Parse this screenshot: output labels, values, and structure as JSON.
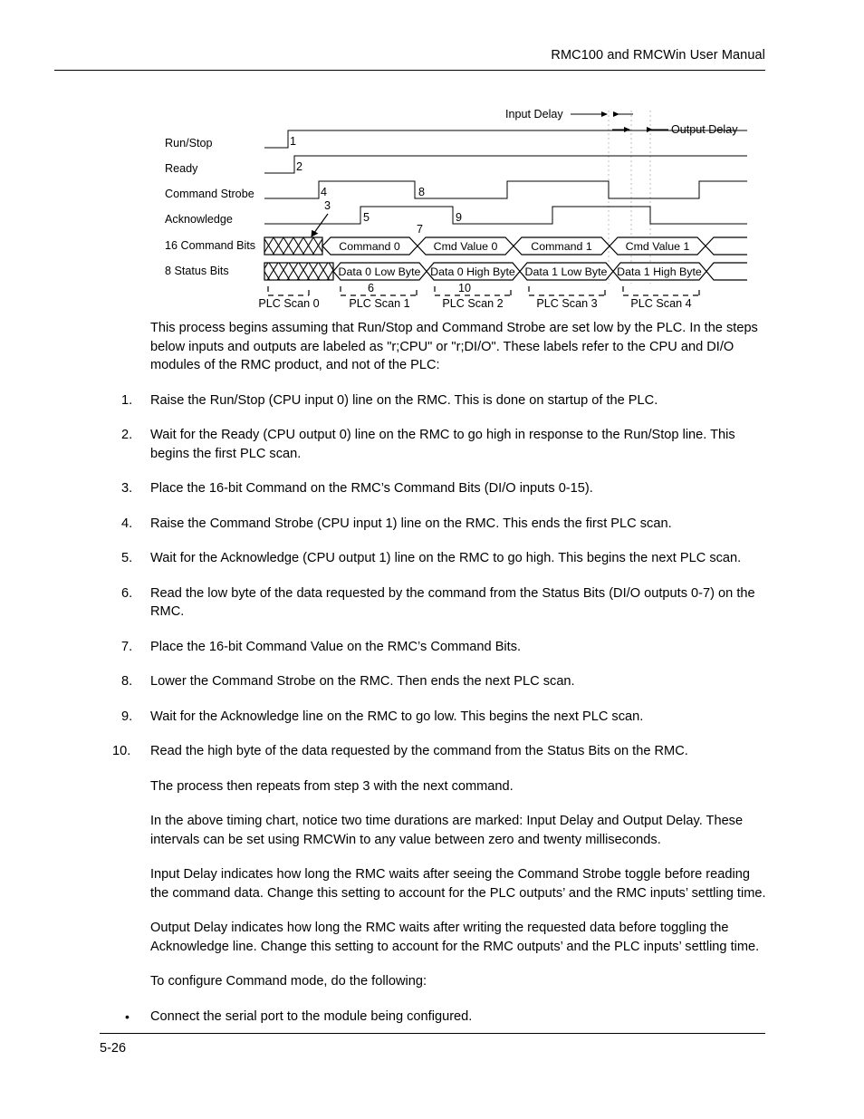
{
  "header": {
    "title": "RMC100 and RMCWin User Manual"
  },
  "footer": {
    "page_number": "5-26"
  },
  "figure": {
    "name": "command-mode-timing-chart",
    "signal_labels": [
      "Run/Stop",
      "Ready",
      "Command Strobe",
      "Acknowledge",
      "16 Command Bits",
      "8 Status Bits"
    ],
    "delay_annotations": [
      "Input Delay",
      "Output Delay"
    ],
    "step_markers": [
      "1",
      "2",
      "3",
      "4",
      "5",
      "6",
      "7",
      "8",
      "9",
      "10"
    ],
    "command_bus_values": [
      "Command 0",
      "Cmd Value 0",
      "Command 1",
      "Cmd Value 1"
    ],
    "status_bus_values": [
      "Data 0 Low Byte",
      "Data 0 High Byte",
      "Data 1 Low Byte",
      "Data 1 High Byte"
    ],
    "scan_labels": [
      "PLC Scan 0",
      "PLC Scan 1",
      "PLC Scan 2",
      "PLC Scan 3",
      "PLC Scan 4"
    ]
  },
  "body": {
    "intro": "This process begins assuming that Run/Stop and Command Strobe are set low by the PLC. In the steps below inputs and outputs are labeled as \"r;CPU\" or \"r;DI/O\". These labels refer to the CPU and DI/O modules of the RMC product, and not of the PLC:",
    "steps": [
      {
        "num": "1.",
        "text": "Raise the Run/Stop (CPU input 0) line on the RMC. This is done on startup of the PLC."
      },
      {
        "num": "2.",
        "text": "Wait for the Ready (CPU output 0) line on the RMC to go high in response to the Run/Stop line. This begins the first PLC scan."
      },
      {
        "num": "3.",
        "text": "Place the 16-bit Command on the RMC’s Command Bits (DI/O inputs 0-15)."
      },
      {
        "num": "4.",
        "text": "Raise the Command Strobe (CPU input 1) line on the RMC. This ends the first PLC scan."
      },
      {
        "num": "5.",
        "text": "Wait for the Acknowledge (CPU output 1) line on the RMC to go high. This begins the next PLC scan."
      },
      {
        "num": "6.",
        "text": "Read the low byte of the data requested by the command from the Status Bits (DI/O outputs 0-7) on the RMC."
      },
      {
        "num": "7.",
        "text": "Place the 16-bit Command Value on the RMC’s Command Bits."
      },
      {
        "num": "8.",
        "text": "Lower the Command Strobe on the RMC. Then ends the next PLC scan."
      },
      {
        "num": "9.",
        "text": "Wait for the Acknowledge line on the RMC to go low. This begins the next PLC scan."
      },
      {
        "num": "10.",
        "text": "Read the high byte of the data requested by the command from the Status Bits on the RMC."
      }
    ],
    "after_steps": [
      "The process then repeats from step 3 with the next command.",
      "In the above timing chart, notice two time durations are marked: Input Delay and Output Delay. These intervals can be set using RMCWin to any value between zero and twenty milliseconds.",
      "Input Delay indicates how long the RMC waits after seeing the Command Strobe toggle before reading the command data. Change this setting to account for the PLC outputs’ and the RMC inputs’ settling time.",
      "Output Delay indicates how long the RMC waits after writing the requested data before toggling the Acknowledge line. Change this setting to account for the RMC outputs’ and the PLC inputs’ settling time.",
      "To configure Command mode, do the following:"
    ],
    "bullets": [
      {
        "marker": "•",
        "text": "Connect the serial port to the module being configured."
      }
    ]
  },
  "colors": {
    "ink": "#000000",
    "paper": "#ffffff",
    "rule": "#000000"
  }
}
